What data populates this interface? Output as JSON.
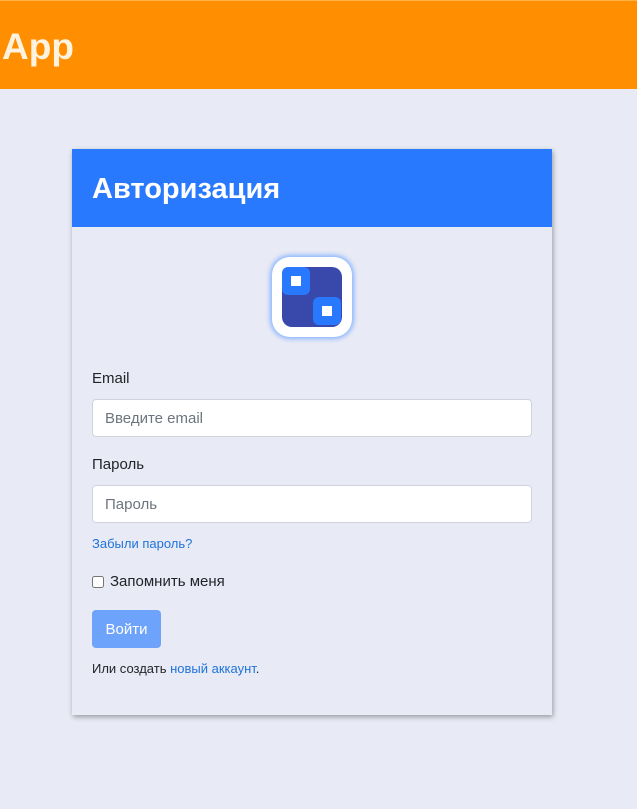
{
  "header": {
    "app_title": "App",
    "background_color": "#ff8f00"
  },
  "login_card": {
    "title": "Авторизация",
    "header_color": "#2979ff",
    "logo_icon": "app-logo-icon",
    "email": {
      "label": "Email",
      "placeholder": "Введите email",
      "value": ""
    },
    "password": {
      "label": "Пароль",
      "placeholder": "Пароль",
      "value": ""
    },
    "forgot_password_link": "Забыли пароль?",
    "remember_me": {
      "label": "Запомнить меня",
      "checked": false
    },
    "submit_button": "Войти",
    "signup": {
      "prefix": "Или создать ",
      "link_text": "новый аккаунт",
      "suffix": "."
    }
  }
}
